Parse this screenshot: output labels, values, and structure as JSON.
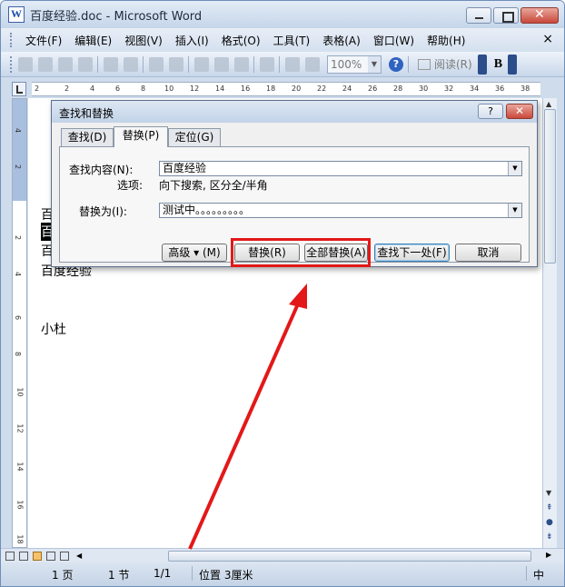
{
  "window": {
    "title": "百度经验.doc - Microsoft Word"
  },
  "menu": {
    "items": [
      "文件(F)",
      "编辑(E)",
      "视图(V)",
      "插入(I)",
      "格式(O)",
      "工具(T)",
      "表格(A)",
      "窗口(W)",
      "帮助(H)"
    ],
    "close": "×"
  },
  "toolbar": {
    "zoom": "100%",
    "read": "阅读(R)",
    "bold": "B"
  },
  "ruler": {
    "ticks": [
      "2",
      "2",
      "4",
      "6",
      "8",
      "10",
      "12",
      "14",
      "16",
      "18",
      "20",
      "22",
      "24",
      "26",
      "28",
      "30",
      "32",
      "34",
      "36",
      "38"
    ],
    "vticks": [
      "4",
      "2",
      "2",
      "4",
      "6",
      "8",
      "10",
      "12",
      "14",
      "16",
      "18"
    ]
  },
  "document": {
    "lines": [
      "百",
      "百",
      "百",
      "百度经验",
      "小杜"
    ]
  },
  "dialog": {
    "title": "查找和替换",
    "help": "?",
    "close": "✕",
    "tabs": [
      "查找(D)",
      "替换(P)",
      "定位(G)"
    ],
    "find_label": "查找内容(N):",
    "find_value": "百度经验",
    "options_label": "选项:",
    "options_value": "向下搜索, 区分全/半角",
    "replace_label": "替换为(I):",
    "replace_value": "测试中。。。。。。。。。",
    "buttons": {
      "more": "高级 ▾ (M)",
      "replace": "替换(R)",
      "replace_all": "全部替换(A)",
      "find_next": "查找下一处(F)",
      "cancel": "取消"
    }
  },
  "status": {
    "page": "1 页",
    "section": "1 节",
    "pages": "1/1",
    "position": "位置 3厘米",
    "lang": "中"
  },
  "accent": {
    "annotation": "#e31818",
    "title_gradient": "#c5d6ea"
  }
}
